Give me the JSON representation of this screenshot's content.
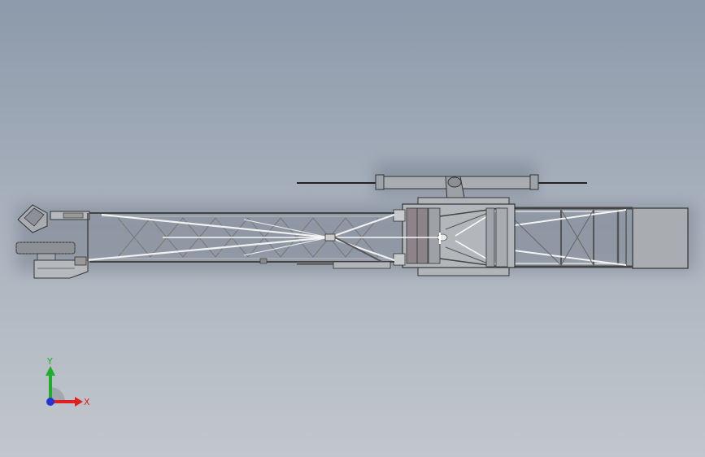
{
  "viewport": {
    "background_top": "#8d9aab",
    "background_bottom": "#c2c7cd"
  },
  "triad": {
    "x_label": "X",
    "y_label": "Y",
    "x_color": "#e0201f",
    "y_color": "#1fae2a",
    "z_color": "#2433d4"
  }
}
